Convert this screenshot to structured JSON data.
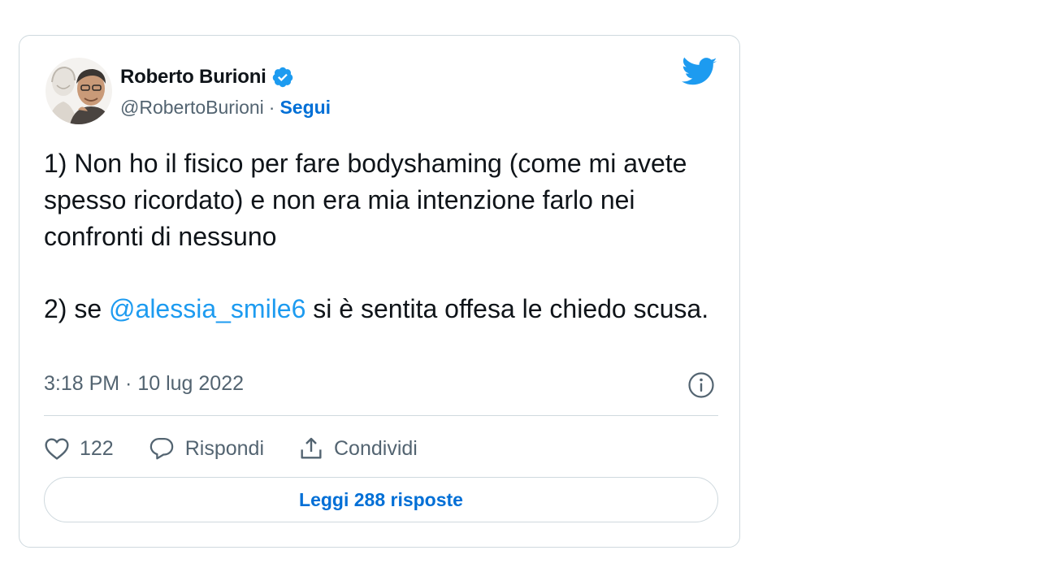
{
  "author": {
    "name": "Roberto Burioni",
    "handle": "@RobertoBurioni",
    "separator": "·",
    "follow_label": "Segui"
  },
  "tweet": {
    "line1": "1) Non ho il fisico per fare bodyshaming (come mi avete spesso ricordato) e non era mia intenzione farlo nei confronti di nessuno",
    "line2_prefix": "2) se ",
    "mention": "@alessia_smile6",
    "line2_suffix": " si è sentita offesa le chiedo scusa.",
    "timestamp": "3:18 PM · 10 lug 2022"
  },
  "actions": {
    "like_count": "122",
    "reply_label": "Rispondi",
    "share_label": "Condividi"
  },
  "read_replies_label": "Leggi 288 risposte",
  "icons": {
    "verified": "verified-badge-icon",
    "logo": "twitter-bird-icon",
    "info": "info-icon",
    "like": "heart-icon",
    "reply": "speech-bubble-icon",
    "share": "share-upload-icon"
  },
  "colors": {
    "accent": "#1d9bf0",
    "link_bold": "#006fd6",
    "secondary_text": "#536471",
    "border": "#cfd9de"
  }
}
